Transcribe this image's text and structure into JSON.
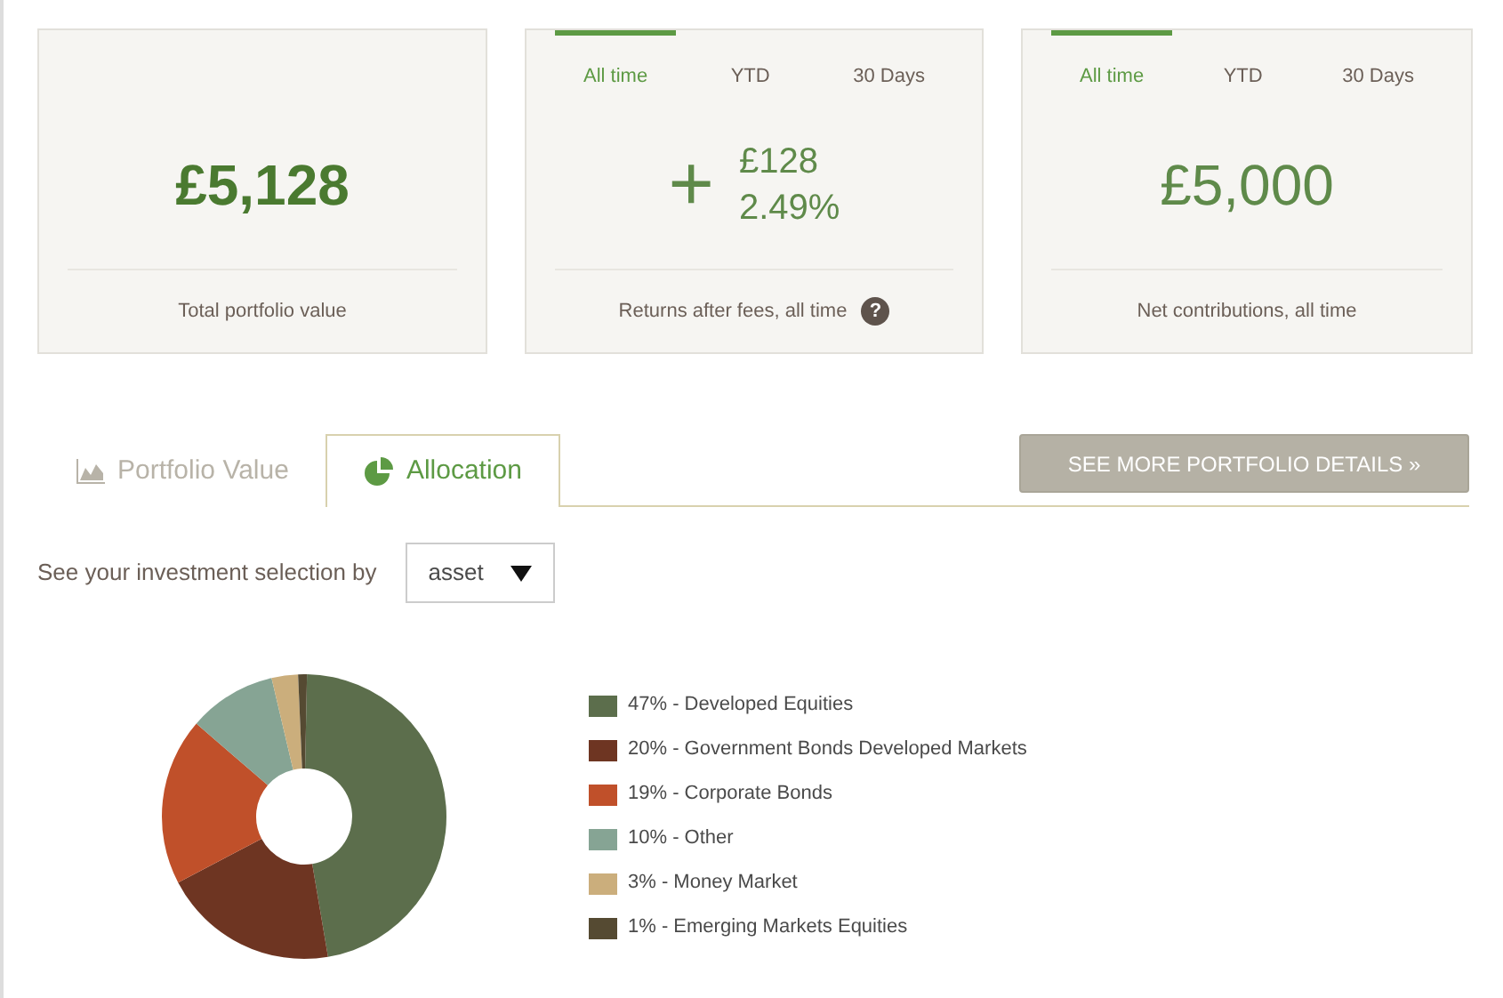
{
  "cards": [
    {
      "kind": "total",
      "value": "£5,128",
      "caption": "Total portfolio value"
    },
    {
      "kind": "returns",
      "tabs": [
        {
          "label": "All time",
          "selected": true
        },
        {
          "label": "YTD",
          "selected": false
        },
        {
          "label": "30 Days",
          "selected": false
        }
      ],
      "sign": "+",
      "amount": "£128",
      "percent": "2.49%",
      "caption": "Returns after fees, all time",
      "help": "?"
    },
    {
      "kind": "plain",
      "tabs": [
        {
          "label": "All time",
          "selected": true
        },
        {
          "label": "YTD",
          "selected": false
        },
        {
          "label": "30 Days",
          "selected": false
        }
      ],
      "value": "£5,000",
      "caption": "Net contributions, all time"
    }
  ],
  "view_tabs": [
    {
      "label": "Portfolio Value",
      "kind": "area",
      "selected": false
    },
    {
      "label": "Allocation",
      "kind": "pie",
      "selected": true
    }
  ],
  "details_button": "SEE MORE PORTFOLIO DETAILS »",
  "selection": {
    "label": "See your investment selection by",
    "value": "asset"
  },
  "allocation": {
    "chart_data": {
      "type": "donut",
      "values": [
        47,
        20,
        19,
        10,
        3,
        1
      ],
      "colors": [
        "#5c6e4c",
        "#6e3522",
        "#c0502a",
        "#86a494",
        "#cbae7c",
        "#554a32"
      ]
    },
    "legend": [
      "47% - Developed Equities",
      "20% - Government Bonds Developed Markets",
      "19% - Corporate Bonds",
      "10% - Other",
      "3% - Money Market",
      "1% - Emerging Markets Equities"
    ]
  }
}
